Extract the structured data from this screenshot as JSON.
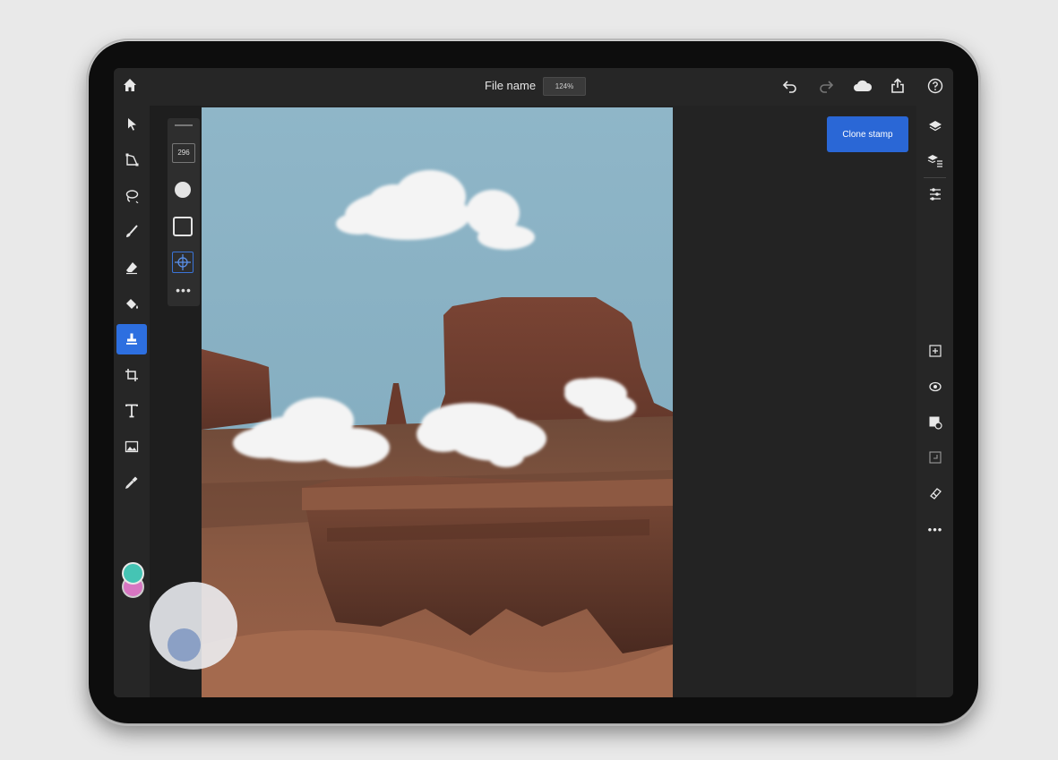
{
  "header": {
    "file_name": "File name",
    "zoom": "124%"
  },
  "tool_options": {
    "brush_size": "296"
  },
  "active_tool": {
    "label": "Clone stamp"
  },
  "colors": {
    "accent": "#2d6fe0",
    "foreground_swatch": "#45c4b4",
    "background_swatch": "#d776c2"
  },
  "icons": {
    "top_left": [
      "home-icon"
    ],
    "top_right": [
      "undo-icon",
      "redo-icon",
      "cloud-icon",
      "share-icon",
      "help-icon"
    ],
    "left_toolbar": [
      "select-icon",
      "transform-icon",
      "lasso-icon",
      "brush-icon",
      "eraser-icon",
      "fill-icon",
      "clone-stamp-icon",
      "crop-icon",
      "text-icon",
      "image-icon",
      "eyedropper-icon"
    ],
    "right_toolbar": [
      "layers-icon",
      "layer-properties-icon",
      "adjustments-icon",
      "add-layer-icon",
      "visibility-icon",
      "mask-icon",
      "arrange-icon",
      "heal-icon",
      "more-icon"
    ]
  }
}
